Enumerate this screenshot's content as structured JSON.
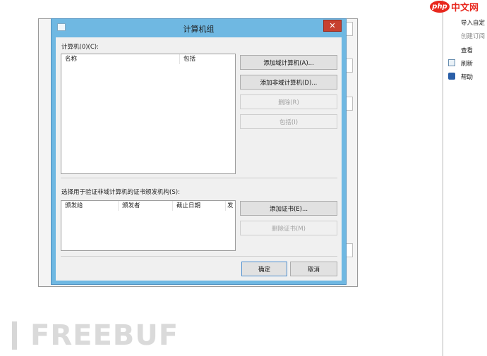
{
  "dialog": {
    "title": "计算机组",
    "close_glyph": "✕",
    "computers_label": "计算机(0)(C):",
    "computers_columns": [
      "名称",
      "包括"
    ],
    "add_domain_button": "添加域计算机(A)...",
    "add_nondomain_button": "添加非域计算机(D)...",
    "remove_button": "删除(R)",
    "include_button": "包括(I)",
    "ca_label": "选择用于验证非域计算机的证书颁发机构(S):",
    "cert_columns": [
      "颁发给",
      "颁发者",
      "截止日期",
      "发"
    ],
    "add_cert_button": "添加证书(E)...",
    "remove_cert_button": "删除证书(M)",
    "ok_button": "确定",
    "cancel_button": "取消"
  },
  "actions_pane": {
    "items": [
      {
        "label": "导入自定",
        "dim": false
      },
      {
        "label": "创建订阅",
        "dim": true
      },
      {
        "label": "查看",
        "dim": false
      },
      {
        "label": "刷新",
        "dim": false,
        "icon": "refresh-icon"
      },
      {
        "label": "帮助",
        "dim": false,
        "icon": "help-icon"
      }
    ]
  },
  "logos": {
    "php_logo_text": "php",
    "php_site_text": "中文网",
    "freebuf_text": "FREEBUF"
  }
}
